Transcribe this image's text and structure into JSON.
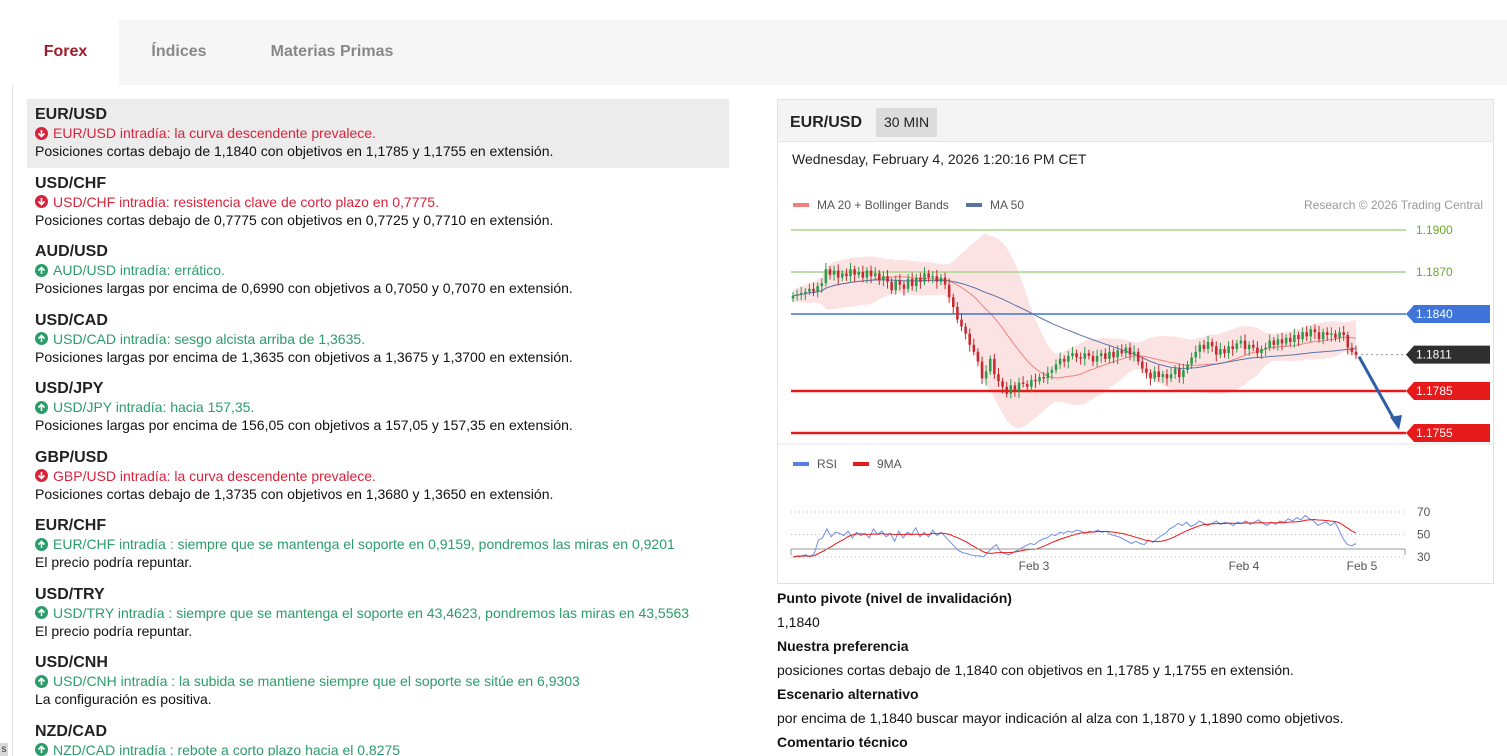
{
  "tabs": [
    {
      "label": "Forex",
      "active": true
    },
    {
      "label": "Índices",
      "active": false
    },
    {
      "label": "Materias Primas",
      "active": false
    }
  ],
  "instruments": [
    {
      "pair": "EUR/USD",
      "direction": "down",
      "headline": "EUR/USD intradía: la curva descendente prevalece.",
      "text": "Posiciones cortas debajo de 1,1840 con objetivos en 1,1785 y 1,1755 en extensión.",
      "selected": true
    },
    {
      "pair": "USD/CHF",
      "direction": "down",
      "headline": "USD/CHF intradía: resistencia clave de corto plazo en 0,7775.",
      "text": "Posiciones cortas debajo de 0,7775 con objetivos en 0,7725 y 0,7710 en extensión."
    },
    {
      "pair": "AUD/USD",
      "direction": "up",
      "headline": "AUD/USD intradía: errático.",
      "text": "Posiciones largas por encima de 0,6990 con objetivos a 0,7050 y 0,7070 en extensión."
    },
    {
      "pair": "USD/CAD",
      "direction": "up",
      "headline": "USD/CAD intradía: sesgo alcista arriba de 1,3635.",
      "text": "Posiciones largas por encima de 1,3635 con objetivos a 1,3675 y 1,3700 en extensión."
    },
    {
      "pair": "USD/JPY",
      "direction": "up",
      "headline": "USD/JPY intradía: hacia 157,35.",
      "text": "Posiciones largas por encima de 156,05 con objetivos a 157,05 y 157,35 en extensión."
    },
    {
      "pair": "GBP/USD",
      "direction": "down",
      "headline": "GBP/USD intradía: la curva descendente prevalece.",
      "text": "Posiciones cortas debajo de 1,3735 con objetivos en 1,3680 y 1,3650 en extensión."
    },
    {
      "pair": "EUR/CHF",
      "direction": "up",
      "headline": "EUR/CHF intradía : siempre que se mantenga el soporte en 0,9159, pondremos las miras en 0,9201",
      "text": "El precio podría repuntar."
    },
    {
      "pair": "USD/TRY",
      "direction": "up",
      "headline": "USD/TRY intradía : siempre que se mantenga el soporte en 43,4623, pondremos las miras en 43,5563",
      "text": "El precio podría repuntar."
    },
    {
      "pair": "USD/CNH",
      "direction": "up",
      "headline": "USD/CNH intradía : la subida se mantiene siempre que el soporte se sitúe en 6,9303",
      "text": "La configuración es positiva."
    },
    {
      "pair": "NZD/CAD",
      "direction": "up",
      "headline": "NZD/CAD intradía : rebote a corto plazo hacia el 0,8275",
      "text": ""
    }
  ],
  "chart": {
    "pair": "EUR/USD",
    "timeframe": "30 MIN",
    "datetime": "Wednesday, February 4, 2026 1:20:16 PM CET",
    "legend_ma20": "MA 20 + Bollinger Bands",
    "legend_ma50": "MA 50",
    "credit": "Research © 2026 Trading Central",
    "rsi_legend": "RSI",
    "ma9_legend": "9MA",
    "colors": {
      "up": "#2b9a4a",
      "down": "#c6282d",
      "resistance": "#3f74d8",
      "target": "#e61a1a",
      "current": "#2f2f2f",
      "arrow": "#2e5fa6",
      "ma20": "#f08080",
      "ma50": "#5a74a8"
    }
  },
  "chart_data": {
    "type": "candlestick",
    "price_levels": [
      {
        "label": "1.1900",
        "value": 1.19,
        "kind": "level"
      },
      {
        "label": "1.1870",
        "value": 1.187,
        "kind": "level"
      },
      {
        "label": "1.1840",
        "value": 1.184,
        "kind": "pivot"
      },
      {
        "label": "1.1811",
        "value": 1.1811,
        "kind": "current"
      },
      {
        "label": "1.1785",
        "value": 1.1785,
        "kind": "target"
      },
      {
        "label": "1.1755",
        "value": 1.1755,
        "kind": "target"
      }
    ],
    "rsi_ticks": [
      "70",
      "50",
      "30"
    ],
    "x_ticks": [
      "Feb 3",
      "Feb 4",
      "Feb 5"
    ],
    "close": [
      1.1853,
      1.1854,
      1.1855,
      1.1856,
      1.1858,
      1.1856,
      1.186,
      1.1862,
      1.1872,
      1.1868,
      1.1871,
      1.1866,
      1.1869,
      1.1867,
      1.1872,
      1.1868,
      1.187,
      1.1866,
      1.1871,
      1.1867,
      1.1869,
      1.1864,
      1.1867,
      1.1863,
      1.1857,
      1.1864,
      1.1861,
      1.1858,
      1.1865,
      1.186,
      1.1866,
      1.1863,
      1.1869,
      1.1866,
      1.1867,
      1.1863,
      1.1866,
      1.1861,
      1.1852,
      1.1845,
      1.1836,
      1.1831,
      1.1826,
      1.1818,
      1.1813,
      1.1806,
      1.1794,
      1.1799,
      1.1808,
      1.1797,
      1.1792,
      1.1788,
      1.1783,
      1.1789,
      1.1785,
      1.1791,
      1.179,
      1.1788,
      1.1793,
      1.1792,
      1.1795,
      1.1794,
      1.1798,
      1.18,
      1.1804,
      1.1808,
      1.1806,
      1.181,
      1.1812,
      1.1809,
      1.1808,
      1.1812,
      1.181,
      1.1806,
      1.181,
      1.1812,
      1.1808,
      1.1813,
      1.1809,
      1.1814,
      1.1812,
      1.1816,
      1.1811,
      1.1813,
      1.1806,
      1.1801,
      1.1798,
      1.1794,
      1.1799,
      1.1795,
      1.1797,
      1.1794,
      1.1797,
      1.1801,
      1.1795,
      1.18,
      1.1804,
      1.1809,
      1.1813,
      1.1818,
      1.1815,
      1.182,
      1.1817,
      1.1811,
      1.1815,
      1.1812,
      1.1817,
      1.1815,
      1.1819,
      1.1821,
      1.1815,
      1.1818,
      1.1816,
      1.1812,
      1.1815,
      1.1816,
      1.1821,
      1.1818,
      1.1822,
      1.1819,
      1.1823,
      1.182,
      1.1825,
      1.1822,
      1.1827,
      1.1824,
      1.1829,
      1.1827,
      1.1822,
      1.1827,
      1.1825,
      1.1826,
      1.1823,
      1.1827,
      1.1825,
      1.1816,
      1.1813,
      1.1811
    ],
    "rsi": [
      30,
      31,
      31,
      32,
      30,
      33,
      45,
      47,
      55,
      48,
      52,
      51,
      49,
      53,
      47,
      52,
      49,
      51,
      47,
      55,
      50,
      53,
      48,
      51,
      44,
      53,
      47,
      52,
      50,
      56,
      48,
      52,
      48,
      54,
      49,
      52,
      48,
      44,
      40,
      36,
      34,
      33,
      32,
      31,
      31,
      30,
      34,
      38,
      41,
      35,
      33,
      32,
      34,
      36,
      38,
      40,
      42,
      41,
      44,
      46,
      47,
      50,
      49,
      52,
      51,
      53,
      52,
      54,
      53,
      51,
      53,
      52,
      54,
      52,
      53,
      50,
      49,
      48,
      46,
      44,
      42,
      44,
      42,
      41,
      45,
      43,
      46,
      49,
      51,
      55,
      57,
      60,
      58,
      61,
      57,
      59,
      62,
      60,
      58,
      60,
      62,
      59,
      61,
      60,
      58,
      61,
      60,
      62,
      59,
      61,
      63,
      60,
      58,
      61,
      59,
      62,
      61,
      64,
      62,
      65,
      63,
      67,
      64,
      62,
      58,
      60,
      61,
      58,
      61,
      54,
      46,
      41,
      40,
      42
    ]
  },
  "details": {
    "pivot_label": "Punto pivote (nivel de invalidación)",
    "pivot_value": "1,1840",
    "preference_label": "Nuestra preferencia",
    "preference_text": "posiciones cortas debajo de 1,1840 con objetivos en 1,1785 y 1,1755 en extensión.",
    "alt_label": "Escenario alternativo",
    "alt_text": "por encima de 1,1840 buscar mayor indicación al alza con 1,1870 y 1,1890 como objetivos.",
    "comment_label": "Comentario técnico"
  },
  "corner_text": "s"
}
